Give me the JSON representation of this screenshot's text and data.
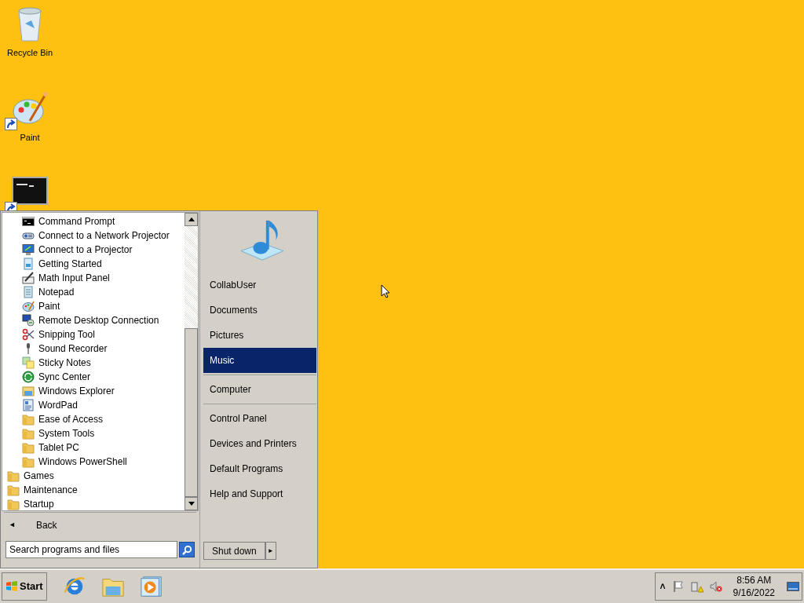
{
  "desktop_icons": [
    {
      "label": "Recycle Bin",
      "kind": "recycle",
      "shortcut": false
    },
    {
      "label": "Paint",
      "kind": "paint",
      "shortcut": true
    },
    {
      "kind": "console",
      "shortcut": true
    }
  ],
  "start_menu": {
    "accessories_items": [
      {
        "label": "Command Prompt",
        "kind": "console"
      },
      {
        "label": "Connect to a Network Projector",
        "kind": "projector"
      },
      {
        "label": "Connect to a Projector",
        "kind": "monitor"
      },
      {
        "label": "Getting Started",
        "kind": "document"
      },
      {
        "label": "Math Input Panel",
        "kind": "pen"
      },
      {
        "label": "Notepad",
        "kind": "notepad"
      },
      {
        "label": "Paint",
        "kind": "paint"
      },
      {
        "label": "Remote Desktop Connection",
        "kind": "remote"
      },
      {
        "label": "Snipping Tool",
        "kind": "scissors"
      },
      {
        "label": "Sound Recorder",
        "kind": "microphone"
      },
      {
        "label": "Sticky Notes",
        "kind": "notes"
      },
      {
        "label": "Sync Center",
        "kind": "sync"
      },
      {
        "label": "Windows Explorer",
        "kind": "explorer"
      },
      {
        "label": "WordPad",
        "kind": "wordpad"
      },
      {
        "label": "Ease of Access",
        "kind": "folder"
      },
      {
        "label": "System Tools",
        "kind": "folder"
      },
      {
        "label": "Tablet PC",
        "kind": "folder"
      },
      {
        "label": "Windows PowerShell",
        "kind": "folder"
      }
    ],
    "program_folders": [
      {
        "label": "Games",
        "kind": "folder"
      },
      {
        "label": "Maintenance",
        "kind": "folder"
      },
      {
        "label": "Startup",
        "kind": "folder"
      }
    ],
    "back": {
      "arrow": "◄",
      "label": "Back"
    },
    "search": {
      "placeholder": "Search programs and files"
    },
    "right_groups": [
      {
        "items": [
          {
            "label": "CollabUser",
            "selected": false
          },
          {
            "label": "Documents",
            "selected": false
          },
          {
            "label": "Pictures",
            "selected": false
          },
          {
            "label": "Music",
            "selected": true
          }
        ]
      },
      {
        "items": [
          {
            "label": "Computer",
            "selected": false
          }
        ]
      },
      {
        "items": [
          {
            "label": "Control Panel",
            "selected": false
          },
          {
            "label": "Devices and Printers",
            "selected": false
          },
          {
            "label": "Default Programs",
            "selected": false
          },
          {
            "label": "Help and Support",
            "selected": false
          }
        ]
      }
    ],
    "shutdown": {
      "label": "Shut down",
      "arrow": "►"
    }
  },
  "taskbar": {
    "start_label": "Start",
    "pinned": [
      {
        "kind": "browser"
      },
      {
        "kind": "explorer"
      },
      {
        "kind": "media"
      }
    ],
    "tray": {
      "chevron": "˄",
      "time": "8:56 AM",
      "date": "9/16/2022"
    }
  }
}
